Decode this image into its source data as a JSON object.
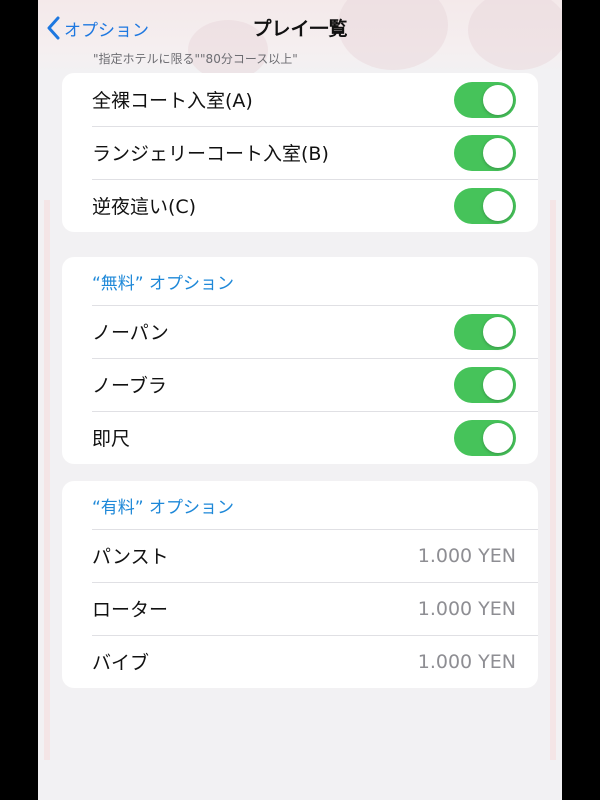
{
  "nav": {
    "back_label": "オプション",
    "title": "プレイ一覧",
    "subtitle": "\"指定ホテルに限る\"\"80分コース以上\""
  },
  "group_a": {
    "items": [
      {
        "label": "全裸コート入室(A)",
        "enabled": true
      },
      {
        "label": "ランジェリーコート入室(B)",
        "enabled": true
      },
      {
        "label": "逆夜這い(C)",
        "enabled": true
      }
    ]
  },
  "free_options": {
    "header": "“無料” オプション",
    "items": [
      {
        "label": "ノーパン",
        "enabled": true
      },
      {
        "label": "ノーブラ",
        "enabled": true
      },
      {
        "label": "即尺",
        "enabled": true
      }
    ]
  },
  "paid_options": {
    "header": "“有料” オプション",
    "items": [
      {
        "label": "パンスト",
        "price": "1.000 YEN"
      },
      {
        "label": "ローター",
        "price": "1.000 YEN"
      },
      {
        "label": "バイブ",
        "price": "1.000 YEN"
      }
    ]
  },
  "colors": {
    "accent_blue": "#1e78e0",
    "toggle_on": "#46c35a",
    "background": "#f2f1f3"
  },
  "icons": {
    "back": "chevron-left-icon"
  }
}
